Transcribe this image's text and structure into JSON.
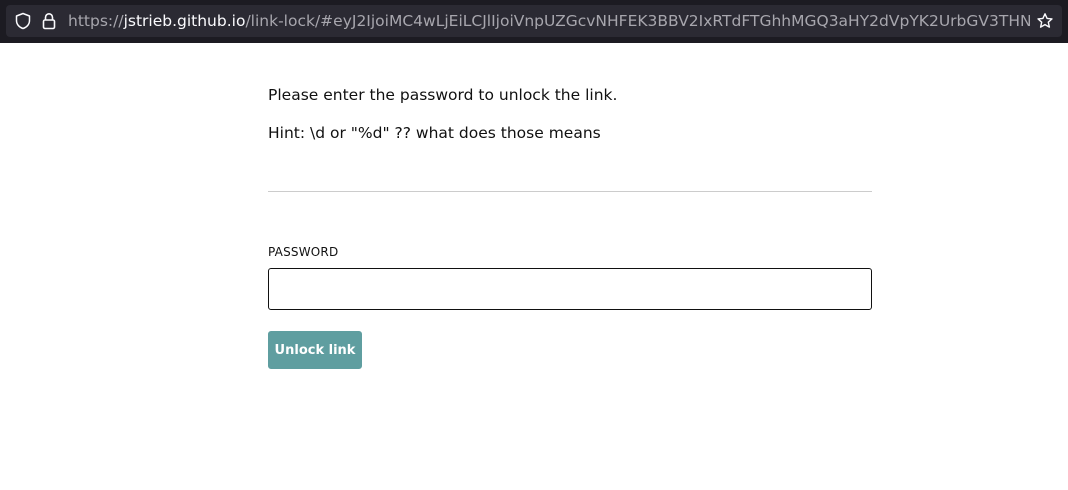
{
  "browser": {
    "url_scheme": "https://",
    "url_host": "jstrieb.github.io",
    "url_rest": "/link-lock/#eyJ2IjoiMC4wLjEiLCJlIjoiVnpUZGcvNHFEK3BBV2IxRTdFTGhhMGQ3aHY2dVpYK2UrbGV3THN",
    "icons": [
      "shield-icon",
      "lock-icon",
      "star-icon"
    ]
  },
  "page": {
    "message": "Please enter the password to unlock the link.",
    "hint": "Hint: \\d or \"%d\" ?? what does those means"
  },
  "form": {
    "password_label": "PASSWORD",
    "password_value": "",
    "unlock_label": "Unlock link"
  },
  "colors": {
    "button": "#5f9ea0",
    "browser_bar": "#1c1b22",
    "url_field": "#2b2a33"
  }
}
